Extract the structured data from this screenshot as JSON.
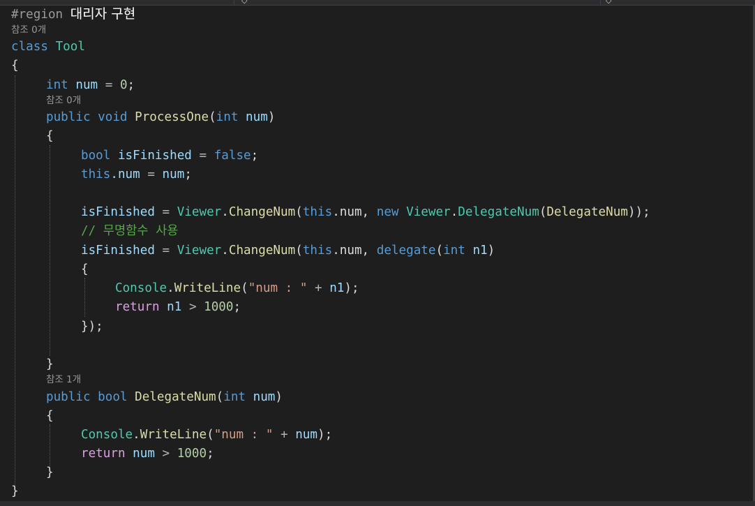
{
  "editor": {
    "theme": {
      "background": "#1e1e1e",
      "keyword": "#569cd6",
      "control": "#d8a0df",
      "type": "#4ec9b0",
      "method": "#dcdcaa",
      "identifier": "#9cdcfe",
      "number": "#b5cea8",
      "string": "#d69d85",
      "comment": "#57a64a"
    },
    "top_strip": {
      "tab_icon_left": "chevron-icon",
      "tab_icon_right": "shield-icon"
    },
    "code": {
      "region_directive": "#region",
      "region_name": "대리자 구현",
      "class_refs": "참조 0개",
      "class_kw": "class",
      "class_name": "Tool",
      "open_brace": "{",
      "close_brace": "}",
      "field": {
        "type": "int",
        "name": "num",
        "eq": "=",
        "value": "0",
        "end": ";"
      },
      "process_one": {
        "refs": "참조 0개",
        "modifier": "public",
        "return_type": "void",
        "name": "ProcessOne",
        "param_open": "(",
        "param_type": "int",
        "param_name": "num",
        "param_close": ")",
        "open_brace": "{",
        "close_brace": "}",
        "line1": {
          "type": "bool",
          "name": "isFinished",
          "eq": "=",
          "value": "false",
          "end": ";"
        },
        "line2": {
          "this_kw": "this",
          "dot_member": ".num",
          "eq": "=",
          "rhs": "num",
          "end": ";"
        },
        "line3": {
          "lhs": "isFinished",
          "eq": "=",
          "cls": "Viewer",
          "dot1": ".",
          "method": "ChangeNum",
          "open": "(",
          "this_kw": "this",
          "member": ".num,",
          "new_kw": "new",
          "cls2": "Viewer",
          "dot2": ".",
          "delegate_type": "DelegateNum",
          "open2": "(",
          "arg": "DelegateNum",
          "end": "));"
        },
        "comment": "// 무명함수 사용",
        "line4": {
          "lhs": "isFinished",
          "eq": "=",
          "cls": "Viewer",
          "dot1": ".",
          "method": "ChangeNum",
          "open": "(",
          "this_kw": "this",
          "member": ".num,",
          "delegate_kw": "delegate",
          "open2": "(",
          "param_type": "int",
          "param_name": "n1",
          "close2": ")"
        },
        "anon_open": "{",
        "anon_line1": {
          "cls": "Console",
          "dot": ".",
          "method": "WriteLine",
          "open": "(",
          "str": "\"num : \"",
          "plus": "+",
          "arg": "n1",
          "end": ");"
        },
        "anon_line2": {
          "ret": "return",
          "lhs": "n1",
          "op": ">",
          "value": "1000",
          "end": ";"
        },
        "anon_close": "});"
      },
      "delegate_num": {
        "refs": "참조 1개",
        "modifier": "public",
        "return_type": "bool",
        "name": "DelegateNum",
        "param_open": "(",
        "param_type": "int",
        "param_name": "num",
        "param_close": ")",
        "open_brace": "{",
        "close_brace": "}",
        "line1": {
          "cls": "Console",
          "dot": ".",
          "method": "WriteLine",
          "open": "(",
          "str": "\"num : \"",
          "plus": "+",
          "arg": "num",
          "end": ");"
        },
        "line2": {
          "ret": "return",
          "lhs": "num",
          "op": ">",
          "value": "1000",
          "end": ";"
        }
      }
    }
  }
}
